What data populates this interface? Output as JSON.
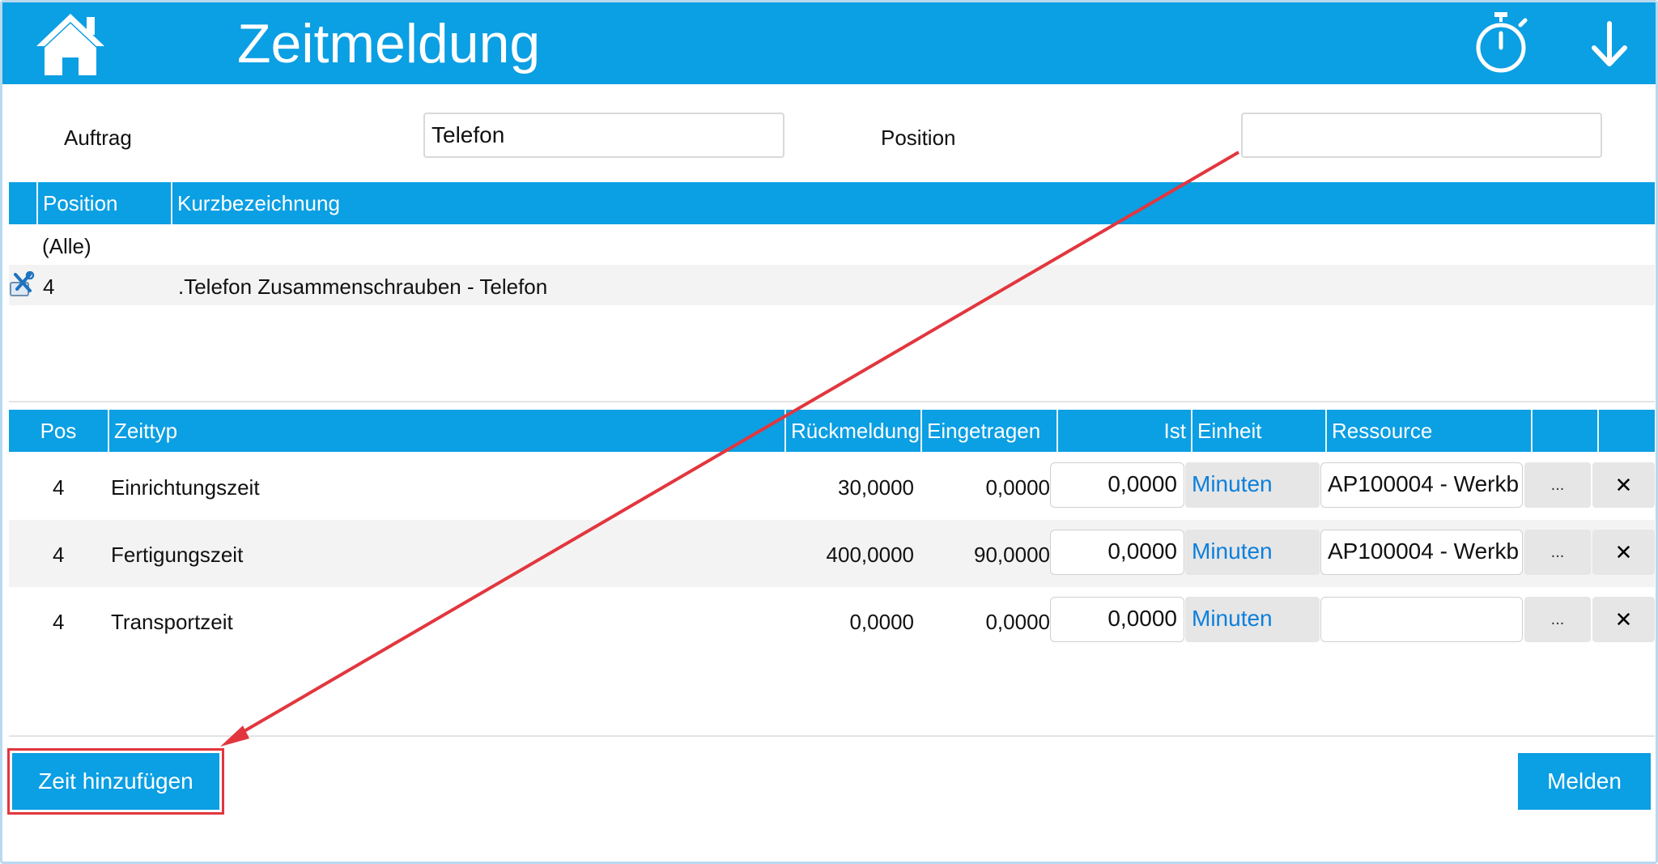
{
  "header": {
    "title": "Zeitmeldung",
    "icons": [
      "home-icon",
      "stopwatch-icon",
      "download-arrow-icon"
    ],
    "color": "#0b9fe3"
  },
  "filter": {
    "auftrag_label": "Auftrag",
    "auftrag_value": "Telefon",
    "position_label": "Position",
    "position_value": ""
  },
  "positions": {
    "columns": [
      "Position",
      "Kurzbezeichnung"
    ],
    "all_label": "(Alle)",
    "rows": [
      {
        "position": "4",
        "kurzbezeichnung": ".Telefon Zusammenschrauben - Telefon",
        "icon": "tools-icon"
      }
    ]
  },
  "times": {
    "columns": [
      "Pos",
      "Zeittyp",
      "Rückmeldung",
      "Eingetragen",
      "Ist",
      "Einheit",
      "Ressource",
      "",
      ""
    ],
    "rows": [
      {
        "pos": "4",
        "zeittyp": "Einrichtungszeit",
        "rueckmeldung": "30,0000",
        "eingetragen": "0,0000",
        "ist": "0,0000",
        "einheit": "Minuten",
        "ressource": "AP100004 - Werkb",
        "more": "...",
        "delete": "✕"
      },
      {
        "pos": "4",
        "zeittyp": "Fertigungszeit",
        "rueckmeldung": "400,0000",
        "eingetragen": "90,0000",
        "ist": "0,0000",
        "einheit": "Minuten",
        "ressource": "AP100004 - Werkb",
        "more": "...",
        "delete": "✕"
      },
      {
        "pos": "4",
        "zeittyp": "Transportzeit",
        "rueckmeldung": "0,0000",
        "eingetragen": "0,0000",
        "ist": "0,0000",
        "einheit": "Minuten",
        "ressource": "",
        "more": "...",
        "delete": "✕"
      }
    ]
  },
  "footer": {
    "add_time_label": "Zeit hinzufügen",
    "report_label": "Melden"
  },
  "annotation": {
    "color": "#e2363e"
  }
}
